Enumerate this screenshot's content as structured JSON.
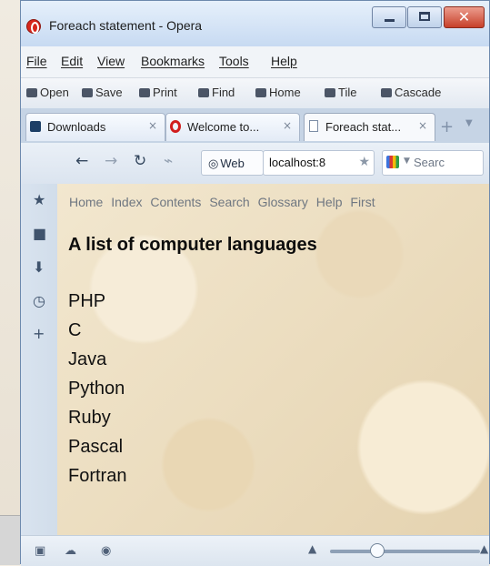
{
  "window": {
    "title": "Foreach statement - Opera"
  },
  "menu": [
    "File",
    "Edit",
    "View",
    "Bookmarks",
    "Tools",
    "Help"
  ],
  "toolbar": [
    "Open",
    "Save",
    "Print",
    "Find",
    "Home",
    "Tile",
    "Cascade"
  ],
  "tabs": [
    {
      "label": "Downloads",
      "close": "×"
    },
    {
      "label": "Welcome to...",
      "close": "×"
    },
    {
      "label": "Foreach stat...",
      "close": "×"
    }
  ],
  "navigation": {
    "web_label": "Web",
    "address": "localhost:8",
    "search_placeholder": "Searc"
  },
  "page": {
    "nav_links": [
      "Home",
      "Index",
      "Contents",
      "Search",
      "Glossary",
      "Help",
      "First"
    ],
    "heading": "A list of computer languages",
    "languages": [
      "PHP",
      "C",
      "Java",
      "Python",
      "Ruby",
      "Pascal",
      "Fortran"
    ]
  },
  "zoom": {
    "level": 0.29
  }
}
